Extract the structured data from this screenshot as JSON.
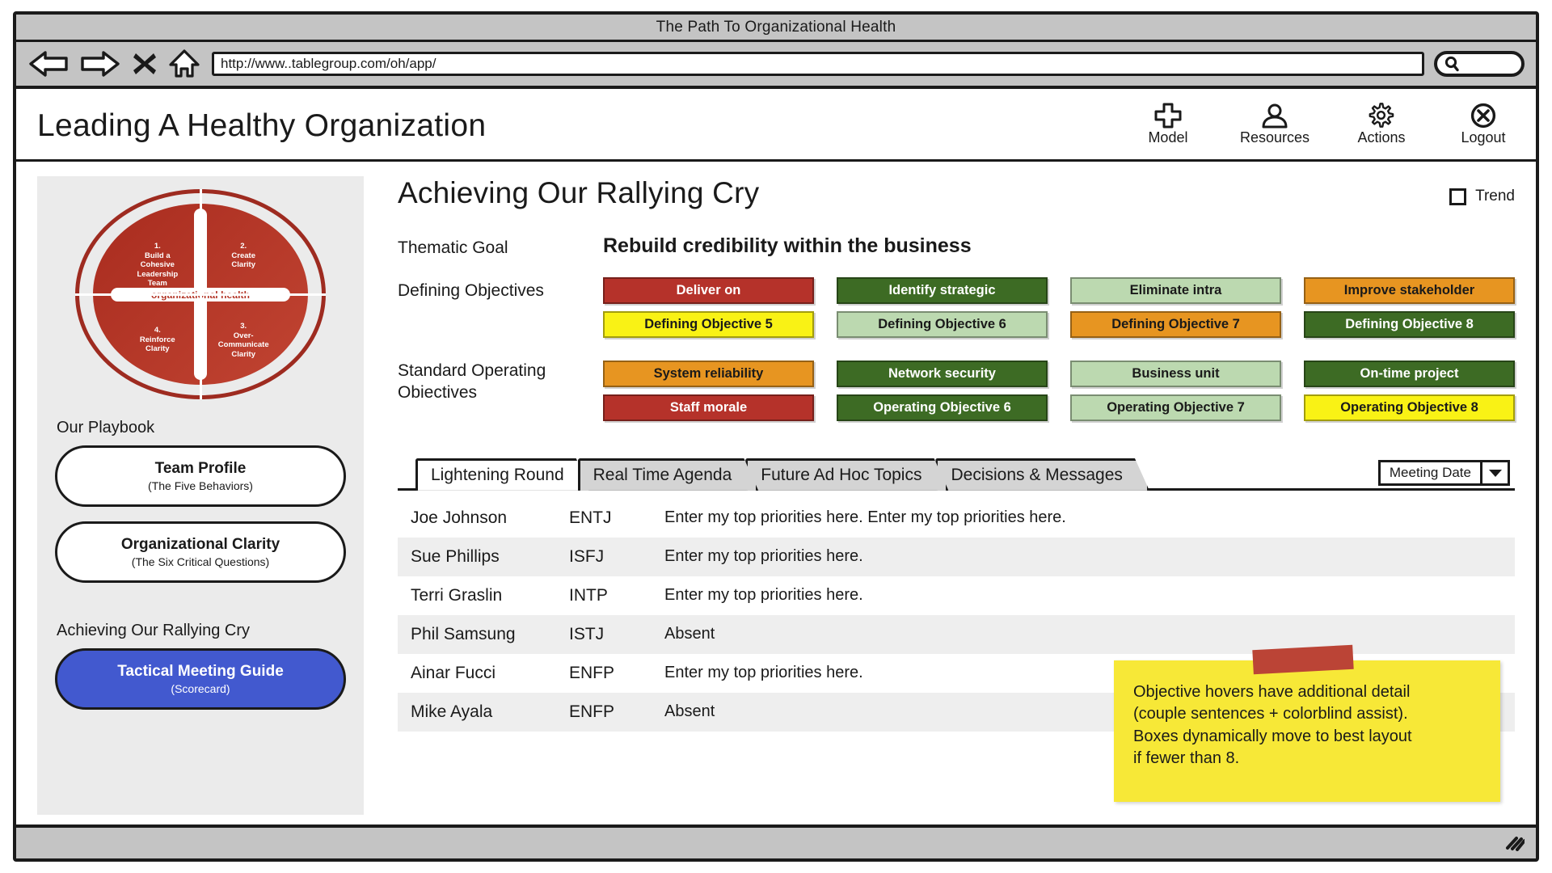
{
  "browser": {
    "window_title": "The Path To Organizational Health",
    "url": "http://www..tablegroup.com/oh/app/",
    "back_icon": "back-arrow-icon",
    "forward_icon": "forward-arrow-icon",
    "stop_icon": "stop-x-icon",
    "home_icon": "home-icon",
    "search_icon": "search-icon",
    "resize_icon": "resize-grip-icon"
  },
  "header": {
    "title": "Leading A Healthy Organization",
    "nav": [
      {
        "label": "Model",
        "icon": "plus-icon"
      },
      {
        "label": "Resources",
        "icon": "person-icon"
      },
      {
        "label": "Actions",
        "icon": "gear-icon"
      },
      {
        "label": "Logout",
        "icon": "close-circle-icon"
      }
    ]
  },
  "sidebar": {
    "model": {
      "center_label": "organizational health",
      "quadrants": [
        {
          "num": "1.",
          "text": "Build a\nCohesive\nLeadership\nTeam"
        },
        {
          "num": "2.",
          "text": "Create\nClarity"
        },
        {
          "num": "3.",
          "text": "Over-\nCommunicate\nClarity"
        },
        {
          "num": "4.",
          "text": "Reinforce\nClarity"
        }
      ],
      "color": "#b33426"
    },
    "playbook_heading": "Our Playbook",
    "playbook_items": [
      {
        "title": "Team Profile",
        "subtitle": "(The Five Behaviors)",
        "active": false
      },
      {
        "title": "Organizational Clarity",
        "subtitle": "(The Six Critical Questions)",
        "active": false
      }
    ],
    "rally_heading": "Achieving Our Rallying Cry",
    "rally_items": [
      {
        "title": "Tactical Meeting Guide",
        "subtitle": "(Scorecard)",
        "active": true
      }
    ],
    "accent_color": "#4259cf"
  },
  "main": {
    "page_title": "Achieving Our Rallying Cry",
    "trend_label": "Trend",
    "trend_checked": false,
    "thematic_goal_label": "Thematic Goal",
    "thematic_goal_value": "Rebuild credibility within the business",
    "defining_label": "Defining Objectives",
    "operating_label": "Standard Operating\nObiectives",
    "defining_objectives": [
      {
        "label": "Deliver on",
        "bg": "#b5322a",
        "fg": "#ffffff"
      },
      {
        "label": "Identify strategic",
        "bg": "#3d6b24",
        "fg": "#ffffff"
      },
      {
        "label": "Eliminate intra",
        "bg": "#bcd9b0",
        "fg": "#1a1a1a"
      },
      {
        "label": "Improve stakeholder",
        "bg": "#e79521",
        "fg": "#1a1a1a"
      },
      {
        "label": "Defining Objective 5",
        "bg": "#f9f215",
        "fg": "#1a1a1a"
      },
      {
        "label": "Defining Objective 6",
        "bg": "#bcd9b0",
        "fg": "#1a1a1a"
      },
      {
        "label": "Defining Objective 7",
        "bg": "#e79521",
        "fg": "#1a1a1a"
      },
      {
        "label": "Defining Objective 8",
        "bg": "#3d6b24",
        "fg": "#ffffff"
      }
    ],
    "operating_objectives": [
      {
        "label": "System reliability",
        "bg": "#e79521",
        "fg": "#1a1a1a"
      },
      {
        "label": "Network security",
        "bg": "#3d6b24",
        "fg": "#ffffff"
      },
      {
        "label": "Business unit",
        "bg": "#bcd9b0",
        "fg": "#1a1a1a"
      },
      {
        "label": "On-time project",
        "bg": "#3d6b24",
        "fg": "#ffffff"
      },
      {
        "label": "Staff morale",
        "bg": "#b5322a",
        "fg": "#ffffff"
      },
      {
        "label": "Operating Objective 6",
        "bg": "#3d6b24",
        "fg": "#ffffff"
      },
      {
        "label": "Operating Objective 7",
        "bg": "#bcd9b0",
        "fg": "#1a1a1a"
      },
      {
        "label": "Operating Objective 8",
        "bg": "#f9f215",
        "fg": "#1a1a1a"
      }
    ],
    "tabs": [
      {
        "label": "Lightening Round",
        "active": true
      },
      {
        "label": "Real Time Agenda",
        "active": false
      },
      {
        "label": "Future Ad Hoc Topics",
        "active": false
      },
      {
        "label": "Decisions & Messages",
        "active": false
      }
    ],
    "meeting_date": {
      "value": "Meeting Date",
      "arrow_icon": "chevron-down-icon"
    },
    "participants": [
      {
        "name": "Joe Johnson",
        "type": "ENTJ",
        "note": "Enter my top priorities here.  Enter my top priorities here."
      },
      {
        "name": "Sue Phillips",
        "type": "ISFJ",
        "note": "Enter my top priorities here."
      },
      {
        "name": "Terri Graslin",
        "type": "INTP",
        "note": "Enter my top priorities here."
      },
      {
        "name": "Phil Samsung",
        "type": "ISTJ",
        "note": "Absent"
      },
      {
        "name": "Ainar Fucci",
        "type": "ENFP",
        "note": "Enter my top priorities here."
      },
      {
        "name": "Mike Ayala",
        "type": "ENFP",
        "note": "Absent"
      }
    ],
    "sticky_note": {
      "text": "Objective hovers have additional detail\n(couple sentences + colorblind assist).\nBoxes dynamically move to best layout\nif fewer than 8.",
      "bg": "#f7e837",
      "tape_color": "#bb4436"
    }
  }
}
